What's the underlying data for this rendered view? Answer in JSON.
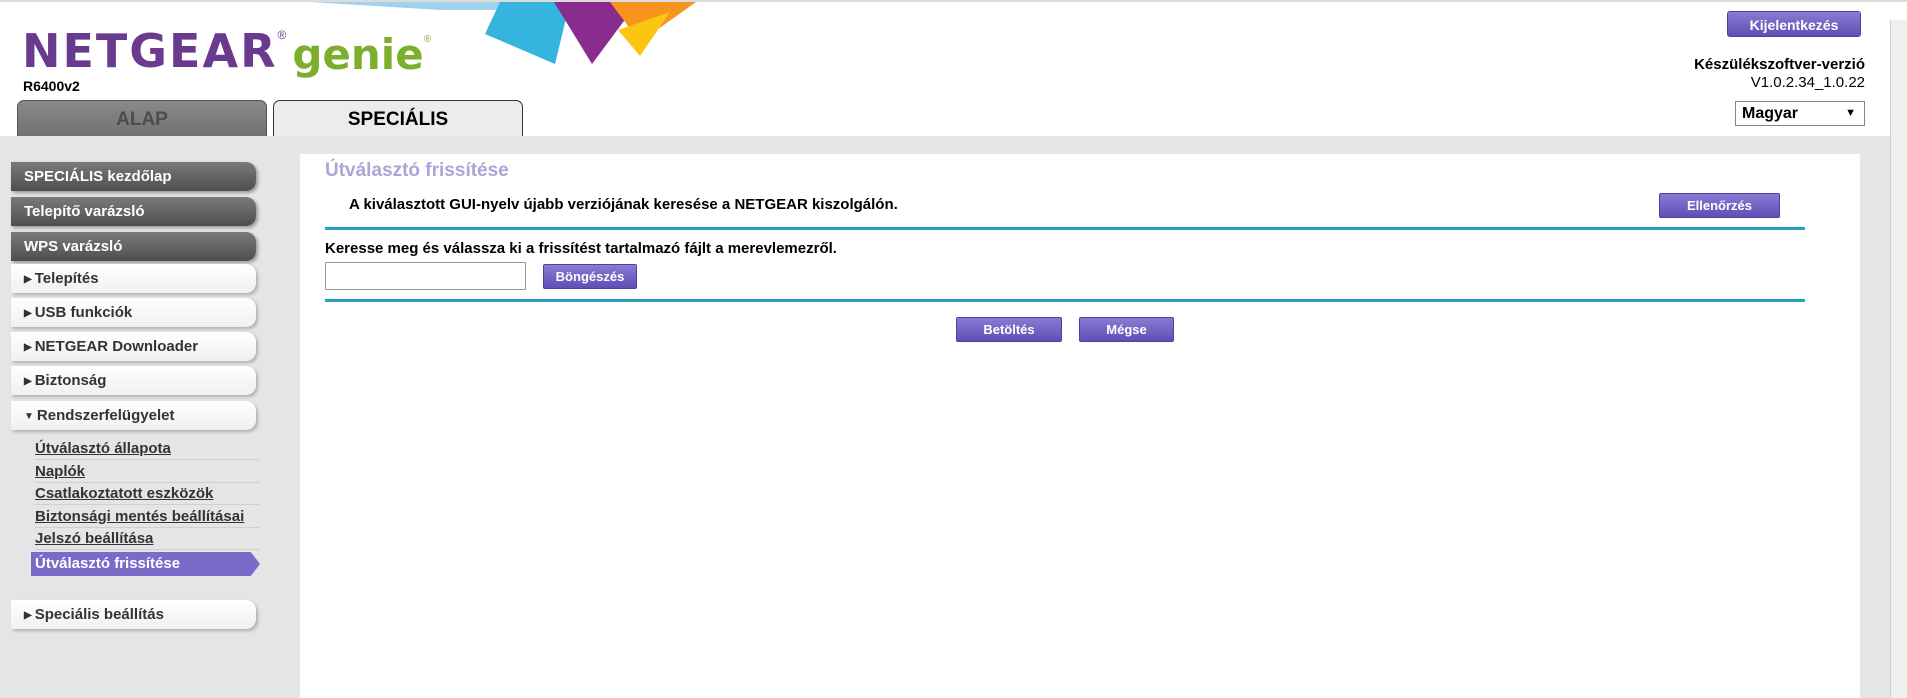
{
  "header": {
    "logo_brand": "NETGEAR",
    "logo_product": "genie",
    "reg_mark": "®",
    "model": "R6400v2",
    "tabs": [
      {
        "label": "ALAP",
        "active": false
      },
      {
        "label": "SPECIÁLIS",
        "active": true
      }
    ],
    "logout_label": "Kijelentkezés",
    "firmware_title": "Készülékszoftver-verzió",
    "firmware_version": "V1.0.2.34_1.0.22",
    "language": "Magyar",
    "language_arrow": "▼"
  },
  "sidebar": {
    "top_items": [
      {
        "label": "SPECIÁLIS kezdőlap"
      },
      {
        "label": "Telepítő varázsló"
      },
      {
        "label": "WPS varázsló"
      }
    ],
    "sections": [
      {
        "label": "Telepítés",
        "expanded": false,
        "arrow": "▶"
      },
      {
        "label": "USB funkciók",
        "expanded": false,
        "arrow": "▶"
      },
      {
        "label": "NETGEAR Downloader",
        "expanded": false,
        "arrow": "▶"
      },
      {
        "label": "Biztonság",
        "expanded": false,
        "arrow": "▶"
      },
      {
        "label": "Rendszerfelügyelet",
        "expanded": true,
        "arrow": "▼"
      }
    ],
    "sub_items": [
      {
        "label": "Útválasztó állapota"
      },
      {
        "label": "Naplók"
      },
      {
        "label": "Csatlakoztatott eszközök"
      },
      {
        "label": "Biztonsági mentés beállításai"
      },
      {
        "label": "Jelszó beállítása"
      },
      {
        "label": "Útválasztó frissítése",
        "active": true
      }
    ],
    "bottom_section": {
      "label": "Speciális beállítás",
      "expanded": false,
      "arrow": "▶"
    }
  },
  "content": {
    "title": "Útválasztó frissítése",
    "check_text": "A kiválasztott GUI-nyelv újabb verziójának keresése a NETGEAR kiszolgálón.",
    "check_button": "Ellenőrzés",
    "file_label": "Keresse meg és válassza ki a frissítést tartalmazó fájlt a merevlemezről.",
    "file_value": "",
    "browse_button": "Böngészés",
    "upload_button": "Betöltés",
    "cancel_button": "Mégse"
  },
  "colors": {
    "accent_purple": "#6a5ac4",
    "brand_purple": "#6a3a8e",
    "brand_green": "#7cb02c",
    "divider_blue": "#2a9fc0",
    "title_lavender": "#a9a6d8"
  }
}
